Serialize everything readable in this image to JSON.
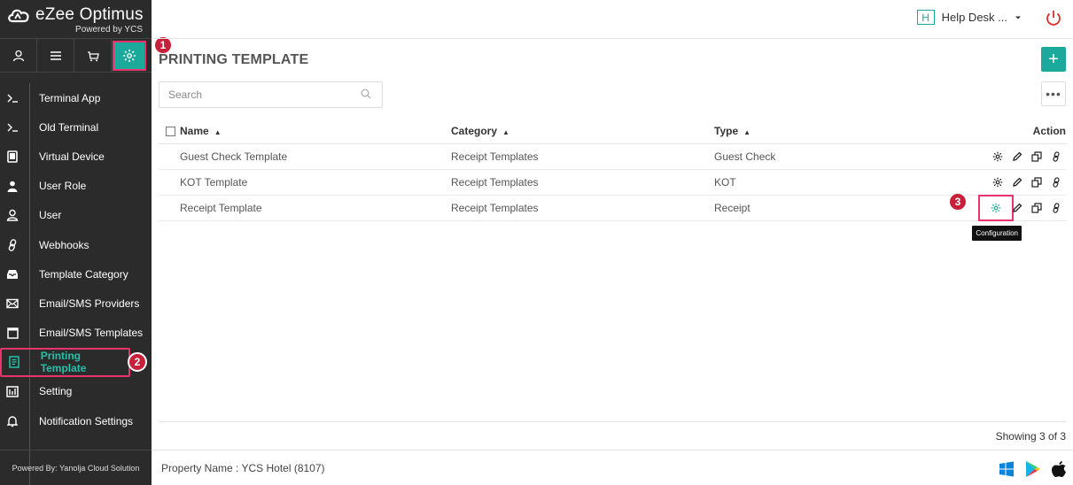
{
  "brand": {
    "name": "eZee Optimus",
    "subtitle": "Powered by YCS"
  },
  "header": {
    "helpdesk_initial": "H",
    "helpdesk_label": "Help Desk ..."
  },
  "badges": {
    "b1": "1",
    "b2": "2",
    "b3": "3"
  },
  "sidebar": {
    "items": [
      {
        "label": "Terminal App",
        "icon": "terminal-icon"
      },
      {
        "label": "Old Terminal",
        "icon": "terminal-icon"
      },
      {
        "label": "Virtual Device",
        "icon": "tablet-icon"
      },
      {
        "label": "User Role",
        "icon": "user-solid-icon"
      },
      {
        "label": "User",
        "icon": "user-icon"
      },
      {
        "label": "Webhooks",
        "icon": "link-icon"
      },
      {
        "label": "Template Category",
        "icon": "inbox-icon"
      },
      {
        "label": "Email/SMS Providers",
        "icon": "mail-icon"
      },
      {
        "label": "Email/SMS Templates",
        "icon": "calendar-icon"
      },
      {
        "label": "Printing Template",
        "icon": "document-icon"
      },
      {
        "label": "Setting",
        "icon": "setting-icon"
      },
      {
        "label": "Notification Settings",
        "icon": "bell-icon"
      }
    ],
    "footer": "Powered By: Yanolja Cloud Solution"
  },
  "main": {
    "title": "PRINTING TEMPLATE",
    "add_label": "+",
    "search_placeholder": "Search",
    "more_label": "•••",
    "columns": {
      "name": "Name",
      "category": "Category",
      "type": "Type",
      "action": "Action"
    },
    "rows": [
      {
        "name": "Guest Check Template",
        "category": "Receipt Templates",
        "type": "Guest Check"
      },
      {
        "name": "KOT Template",
        "category": "Receipt Templates",
        "type": "KOT"
      },
      {
        "name": "Receipt Template",
        "category": "Receipt Templates",
        "type": "Receipt"
      }
    ],
    "tooltip": "Configuration",
    "showing": "Showing 3 of 3",
    "property": "Property Name : YCS Hotel (8107)"
  },
  "colors": {
    "accent": "#1aa99a",
    "highlight": "#e8336d",
    "badge": "#c8203a",
    "sidebar_bg": "#2b2b2b",
    "power": "#d9302c"
  }
}
